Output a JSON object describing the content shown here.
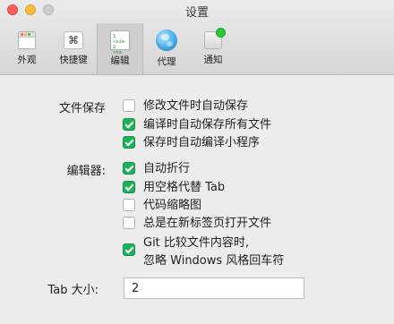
{
  "window": {
    "title": "设置"
  },
  "toolbar": {
    "items": [
      {
        "label": "外观",
        "icon": "appearance-icon"
      },
      {
        "label": "快捷键",
        "icon": "command-key-icon",
        "glyph": "⌘"
      },
      {
        "label": "编辑",
        "icon": "editor-icon",
        "active": true,
        "code_lines": [
          "1 <vie",
          "2 <te"
        ]
      },
      {
        "label": "代理",
        "icon": "globe-icon"
      },
      {
        "label": "通知",
        "icon": "notification-icon"
      }
    ]
  },
  "file_save": {
    "label": "文件保存",
    "options": [
      {
        "text": "修改文件时自动保存",
        "checked": false
      },
      {
        "text": "编译时自动保存所有文件",
        "checked": true
      },
      {
        "text": "保存时自动编译小程序",
        "checked": true
      }
    ]
  },
  "editor": {
    "label": "编辑器:",
    "options": [
      {
        "text": "自动折行",
        "checked": true
      },
      {
        "text": "用空格代替 Tab",
        "checked": true
      },
      {
        "text": "代码缩略图",
        "checked": false
      },
      {
        "text": "总是在新标签页打开文件",
        "checked": false
      },
      {
        "text": "Git 比较文件内容时,",
        "text2": "忽略 Windows 风格回车符",
        "checked": true
      }
    ]
  },
  "tab_size": {
    "label": "Tab 大小:",
    "value": "2"
  },
  "colors": {
    "checkbox_checked": "#1fb25a",
    "close": "#fc605c",
    "minimize": "#fdbc40",
    "zoom": "#cdcdcd"
  }
}
